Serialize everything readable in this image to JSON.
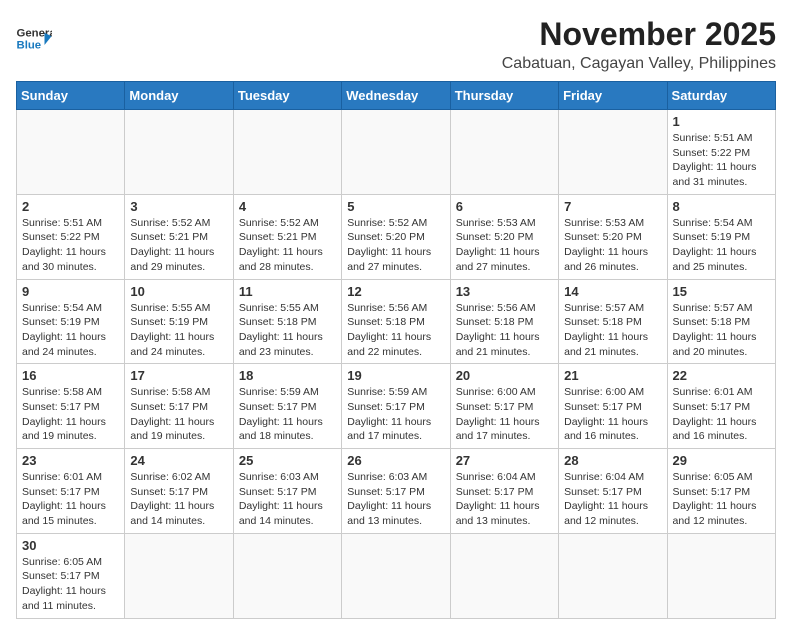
{
  "header": {
    "logo_general": "General",
    "logo_blue": "Blue",
    "title": "November 2025",
    "subtitle": "Cabatuan, Cagayan Valley, Philippines"
  },
  "days_of_week": [
    "Sunday",
    "Monday",
    "Tuesday",
    "Wednesday",
    "Thursday",
    "Friday",
    "Saturday"
  ],
  "weeks": [
    [
      null,
      null,
      null,
      null,
      null,
      null,
      {
        "day": "1",
        "sunrise": "Sunrise: 5:51 AM",
        "sunset": "Sunset: 5:22 PM",
        "daylight": "Daylight: 11 hours and 31 minutes."
      }
    ],
    [
      {
        "day": "2",
        "sunrise": "Sunrise: 5:51 AM",
        "sunset": "Sunset: 5:22 PM",
        "daylight": "Daylight: 11 hours and 30 minutes."
      },
      {
        "day": "3",
        "sunrise": "Sunrise: 5:52 AM",
        "sunset": "Sunset: 5:21 PM",
        "daylight": "Daylight: 11 hours and 29 minutes."
      },
      {
        "day": "4",
        "sunrise": "Sunrise: 5:52 AM",
        "sunset": "Sunset: 5:21 PM",
        "daylight": "Daylight: 11 hours and 28 minutes."
      },
      {
        "day": "5",
        "sunrise": "Sunrise: 5:52 AM",
        "sunset": "Sunset: 5:20 PM",
        "daylight": "Daylight: 11 hours and 27 minutes."
      },
      {
        "day": "6",
        "sunrise": "Sunrise: 5:53 AM",
        "sunset": "Sunset: 5:20 PM",
        "daylight": "Daylight: 11 hours and 27 minutes."
      },
      {
        "day": "7",
        "sunrise": "Sunrise: 5:53 AM",
        "sunset": "Sunset: 5:20 PM",
        "daylight": "Daylight: 11 hours and 26 minutes."
      },
      {
        "day": "8",
        "sunrise": "Sunrise: 5:54 AM",
        "sunset": "Sunset: 5:19 PM",
        "daylight": "Daylight: 11 hours and 25 minutes."
      }
    ],
    [
      {
        "day": "9",
        "sunrise": "Sunrise: 5:54 AM",
        "sunset": "Sunset: 5:19 PM",
        "daylight": "Daylight: 11 hours and 24 minutes."
      },
      {
        "day": "10",
        "sunrise": "Sunrise: 5:55 AM",
        "sunset": "Sunset: 5:19 PM",
        "daylight": "Daylight: 11 hours and 24 minutes."
      },
      {
        "day": "11",
        "sunrise": "Sunrise: 5:55 AM",
        "sunset": "Sunset: 5:18 PM",
        "daylight": "Daylight: 11 hours and 23 minutes."
      },
      {
        "day": "12",
        "sunrise": "Sunrise: 5:56 AM",
        "sunset": "Sunset: 5:18 PM",
        "daylight": "Daylight: 11 hours and 22 minutes."
      },
      {
        "day": "13",
        "sunrise": "Sunrise: 5:56 AM",
        "sunset": "Sunset: 5:18 PM",
        "daylight": "Daylight: 11 hours and 21 minutes."
      },
      {
        "day": "14",
        "sunrise": "Sunrise: 5:57 AM",
        "sunset": "Sunset: 5:18 PM",
        "daylight": "Daylight: 11 hours and 21 minutes."
      },
      {
        "day": "15",
        "sunrise": "Sunrise: 5:57 AM",
        "sunset": "Sunset: 5:18 PM",
        "daylight": "Daylight: 11 hours and 20 minutes."
      }
    ],
    [
      {
        "day": "16",
        "sunrise": "Sunrise: 5:58 AM",
        "sunset": "Sunset: 5:17 PM",
        "daylight": "Daylight: 11 hours and 19 minutes."
      },
      {
        "day": "17",
        "sunrise": "Sunrise: 5:58 AM",
        "sunset": "Sunset: 5:17 PM",
        "daylight": "Daylight: 11 hours and 19 minutes."
      },
      {
        "day": "18",
        "sunrise": "Sunrise: 5:59 AM",
        "sunset": "Sunset: 5:17 PM",
        "daylight": "Daylight: 11 hours and 18 minutes."
      },
      {
        "day": "19",
        "sunrise": "Sunrise: 5:59 AM",
        "sunset": "Sunset: 5:17 PM",
        "daylight": "Daylight: 11 hours and 17 minutes."
      },
      {
        "day": "20",
        "sunrise": "Sunrise: 6:00 AM",
        "sunset": "Sunset: 5:17 PM",
        "daylight": "Daylight: 11 hours and 17 minutes."
      },
      {
        "day": "21",
        "sunrise": "Sunrise: 6:00 AM",
        "sunset": "Sunset: 5:17 PM",
        "daylight": "Daylight: 11 hours and 16 minutes."
      },
      {
        "day": "22",
        "sunrise": "Sunrise: 6:01 AM",
        "sunset": "Sunset: 5:17 PM",
        "daylight": "Daylight: 11 hours and 16 minutes."
      }
    ],
    [
      {
        "day": "23",
        "sunrise": "Sunrise: 6:01 AM",
        "sunset": "Sunset: 5:17 PM",
        "daylight": "Daylight: 11 hours and 15 minutes."
      },
      {
        "day": "24",
        "sunrise": "Sunrise: 6:02 AM",
        "sunset": "Sunset: 5:17 PM",
        "daylight": "Daylight: 11 hours and 14 minutes."
      },
      {
        "day": "25",
        "sunrise": "Sunrise: 6:03 AM",
        "sunset": "Sunset: 5:17 PM",
        "daylight": "Daylight: 11 hours and 14 minutes."
      },
      {
        "day": "26",
        "sunrise": "Sunrise: 6:03 AM",
        "sunset": "Sunset: 5:17 PM",
        "daylight": "Daylight: 11 hours and 13 minutes."
      },
      {
        "day": "27",
        "sunrise": "Sunrise: 6:04 AM",
        "sunset": "Sunset: 5:17 PM",
        "daylight": "Daylight: 11 hours and 13 minutes."
      },
      {
        "day": "28",
        "sunrise": "Sunrise: 6:04 AM",
        "sunset": "Sunset: 5:17 PM",
        "daylight": "Daylight: 11 hours and 12 minutes."
      },
      {
        "day": "29",
        "sunrise": "Sunrise: 6:05 AM",
        "sunset": "Sunset: 5:17 PM",
        "daylight": "Daylight: 11 hours and 12 minutes."
      }
    ],
    [
      {
        "day": "30",
        "sunrise": "Sunrise: 6:05 AM",
        "sunset": "Sunset: 5:17 PM",
        "daylight": "Daylight: 11 hours and 11 minutes."
      },
      null,
      null,
      null,
      null,
      null,
      null
    ]
  ]
}
